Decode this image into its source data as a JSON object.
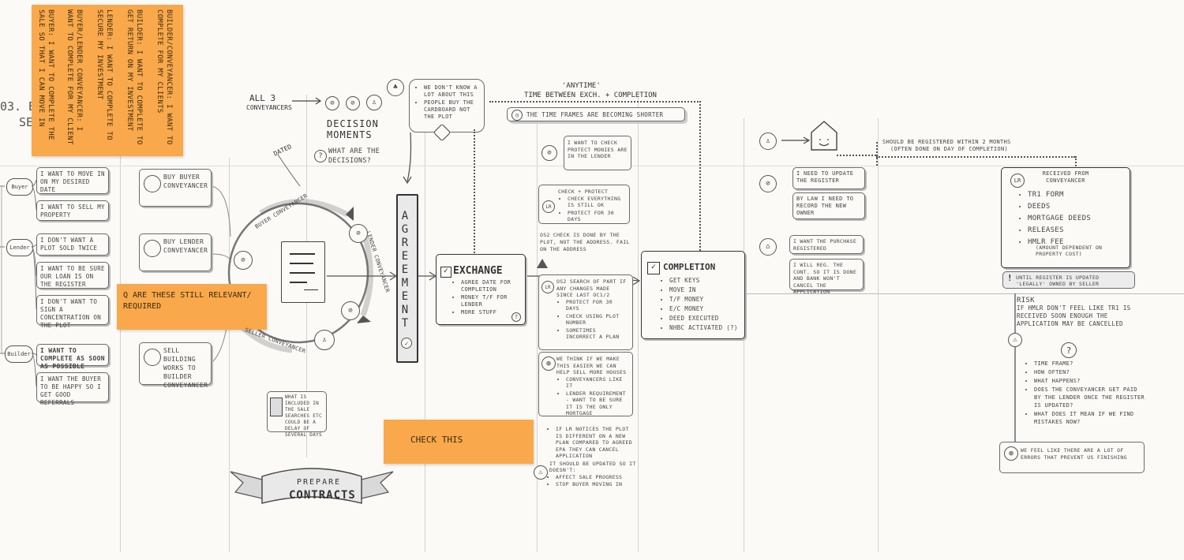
{
  "stage_label": "03. B",
  "stage_label_2": "SE",
  "sticky_notes": [
    "Buyer: I want to complete the sale so that I can move in",
    "Buyer/Lender conveyancer: I want to complete for my client",
    "Lender: I want to complete to secure my investment",
    "Builder: I want to complete to get return on my investment",
    "Builder/Conveyancer: I want to complete for my clients"
  ],
  "question_sticky": "Q Are these still relevant/ required",
  "check_sticky": "CHECK THIS",
  "left_roles": {
    "buyer": "Buyer",
    "lender": "Lender",
    "builder": "Builder"
  },
  "needs": [
    "I want to move in on my desired date",
    "I want to sell my property",
    "I don't want a plot sold twice",
    "I want to be sure our loan is on the register",
    "I don't want to sign a concentration on the plot",
    "I want to complete as soon as possible",
    "I want the buyer to be happy so I get good referrals"
  ],
  "actions": {
    "buy_buyer": "Buy  Buyer conveyancer",
    "buy_lender": "Buy  Lender conveyancer",
    "sell": "Sell  Building works to builder conveyancer"
  },
  "cycle": {
    "all3": "All 3",
    "conveyancers": "Conveyancers",
    "decision_moments": "Decision Moments",
    "decisions_q": "What are the decisions?",
    "dated": "Dated",
    "buyer_conv": "Buyer conveyancer",
    "lender_conv": "Lender conveyancer",
    "seller_conv": "Seller conveyancer",
    "what_included": "What is included in the sale",
    "includes": [
      "Searches etc",
      "Could be a delay of several days"
    ]
  },
  "banner": {
    "line1": "Prepare",
    "line2": "Contracts"
  },
  "agreement": "AGREEMENT",
  "unknown_bubble": [
    "We don't know a lot about this",
    "People buy the cardboard not the plot"
  ],
  "anytime": {
    "line1": "'Anytime'",
    "line2": "Time between exch. + completion"
  },
  "timeframes": "The time frames are becoming shorter",
  "check_protect_bubble": "I want to check protect monies are in the lender",
  "check_protect_box": {
    "line1": "Check + protect",
    "items": [
      "Check everything is still ok",
      "Protect for 30 days"
    ]
  },
  "os2_check": "OS2 check is done by the plot, not the address. Fail on the address",
  "exchange": {
    "title": "Exchange",
    "items": [
      "Agree date for completion",
      "Money T/F for lender",
      "More stuff"
    ]
  },
  "os2_search": {
    "line1": "OS2 search of part if any changes made since last OC1/2",
    "items": [
      "Protect for 30 days",
      "Check using plot number",
      "Sometimes incorrect a plan"
    ]
  },
  "think_note": {
    "line1": "We think if we make this easier we can help sell more houses",
    "items": [
      "Conveyancers like it",
      "Lender requirement - want to be sure it is the only mortgage"
    ]
  },
  "lr_notice": {
    "line1": "If LR notices the plot is different on a new plan compared to agreed EPA they can cancel application",
    "line2": "It should be updated so it doesn't:",
    "items": [
      "Affect sale progress",
      "Stop buyer moving in"
    ]
  },
  "completion": {
    "title": "Completion",
    "items": [
      "Get keys",
      "Move in",
      "T/F money",
      "E/C money",
      "Deed executed",
      "NHBC activated (?)"
    ]
  },
  "register_timing": {
    "line1": "Should be registered within 2 months",
    "line2": "(often done on day of completion)"
  },
  "update_register": "I need to update the register",
  "by_law": "By law I need to record the new owner",
  "purchase_reg": "I want the purchase registered",
  "will_reg": "I will reg. the cont. so it is done and bank won't cancel the application",
  "received": {
    "title": "Received from conveyancer",
    "items": [
      "TR1 form",
      "Deeds",
      "Mortgage deeds",
      "Releases",
      "HMLR fee"
    ],
    "fee_note": "(Amount dependent on property cost)"
  },
  "until_register": "Until register is updated 'legally' owned by seller",
  "risk": {
    "title": "Risk",
    "text": "If HMLR don't feel like TR1 is received soon enough the application may be cancelled"
  },
  "questions": [
    "Time frame?",
    "How often?",
    "What happens?",
    "Does the conveyancer get paid by the lender once the register is updated?",
    "What does it mean if we find mistakes now?"
  ],
  "errors_note": "We feel like there are a lot of errors that prevent us finishing",
  "lr_badge": "LR",
  "question_mark": "?"
}
